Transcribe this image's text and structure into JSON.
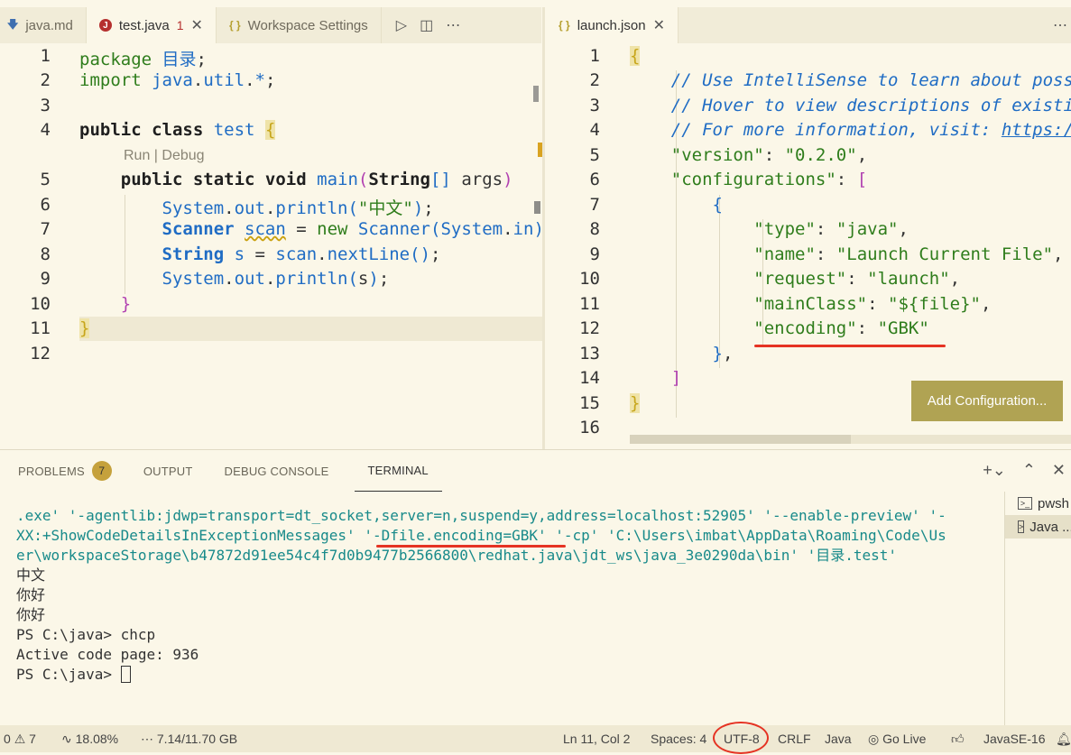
{
  "left_tabs": [
    {
      "label": "java.md",
      "icon": "markdown-icon"
    },
    {
      "label": "test.java",
      "badge": "1",
      "icon": "java-icon"
    },
    {
      "label": "Workspace Settings",
      "icon": "json-braces-icon"
    }
  ],
  "right_tabs": [
    {
      "label": "launch.json",
      "icon": "json-braces-icon"
    }
  ],
  "left_editor": {
    "line_numbers": [
      "1",
      "2",
      "3",
      "4",
      "5",
      "6",
      "7",
      "8",
      "9",
      "10",
      "11",
      "12"
    ],
    "codelens": "Run | Debug"
  },
  "right_editor": {
    "line_numbers": [
      "1",
      "2",
      "3",
      "4",
      "5",
      "6",
      "7",
      "8",
      "9",
      "10",
      "11",
      "12",
      "13",
      "14",
      "15",
      "16"
    ],
    "add_configuration_label": "Add Configuration..."
  },
  "panel": {
    "tabs": [
      "PROBLEMS",
      "OUTPUT",
      "DEBUG CONSOLE",
      "TERMINAL"
    ],
    "problems_count": "7",
    "terminal_lines": [
      ".exe' '-agentlib:jdwp=transport=dt_socket,server=n,suspend=y,address=localhost:52905' '--enable-preview' '-",
      "XX:+ShowCodeDetailsInExceptionMessages' '-Dfile.encoding=GBK' '-cp' 'C:\\Users\\imbat\\AppData\\Roaming\\Code\\Us",
      "er\\workspaceStorage\\b47872d91ee54c4f7d0b9477b2566800\\redhat.java\\jdt_ws\\java_3e0290da\\bin' '目录.test'",
      "中文",
      "你好",
      "你好",
      "PS C:\\java> chcp",
      "Active code page: 936",
      "PS C:\\java> "
    ],
    "terminal_list": [
      "pwsh",
      "Java ..."
    ]
  },
  "statusbar": {
    "errors": "0",
    "warnings": "7",
    "cpu": "18.08%",
    "memory": "7.14/11.70 GB",
    "position": "Ln 11, Col 2",
    "spaces": "Spaces: 4",
    "encoding": "UTF-8",
    "eol": "CRLF",
    "language": "Java",
    "golive": "Go Live",
    "jdk": "JavaSE-16"
  },
  "colors": {
    "background": "#fbf7e8",
    "accent_button": "#b0a353",
    "annotation_red": "#e53323",
    "keyword_green": "#2f7d1c",
    "type_blue": "#1f6cc4"
  }
}
